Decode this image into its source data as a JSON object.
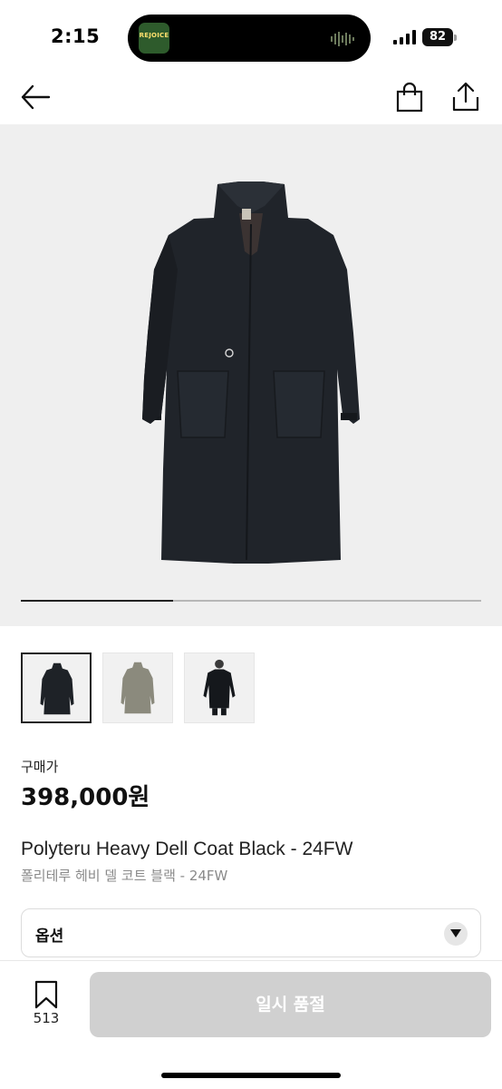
{
  "status_bar": {
    "time": "2:15",
    "battery": "82",
    "island_app_label": "REJOICE"
  },
  "nav": {
    "back_icon": "arrow-left-icon",
    "bag_icon": "shopping-bag-icon",
    "share_icon": "share-icon"
  },
  "gallery": {
    "carousel_progress": 0.33,
    "thumbnails": [
      {
        "name": "coat-front-black",
        "selected": true
      },
      {
        "name": "coat-front-olive",
        "selected": false
      },
      {
        "name": "coat-worn-black",
        "selected": false
      }
    ]
  },
  "price": {
    "label": "구매가",
    "value": "398,000원"
  },
  "product": {
    "title": "Polyteru Heavy Dell Coat Black - 24FW",
    "subtitle": "폴리테루 헤비 델 코트 블랙 - 24FW"
  },
  "option": {
    "label": "옵션",
    "icon": "chevron-down-icon"
  },
  "bottom_bar": {
    "bookmark_count": "513",
    "bookmark_icon": "bookmark-icon",
    "cta_label": "일시 품절"
  },
  "colors": {
    "cta_disabled": "#d0d0d0",
    "hero_bg": "#efefef",
    "coat": "#1e2227"
  }
}
